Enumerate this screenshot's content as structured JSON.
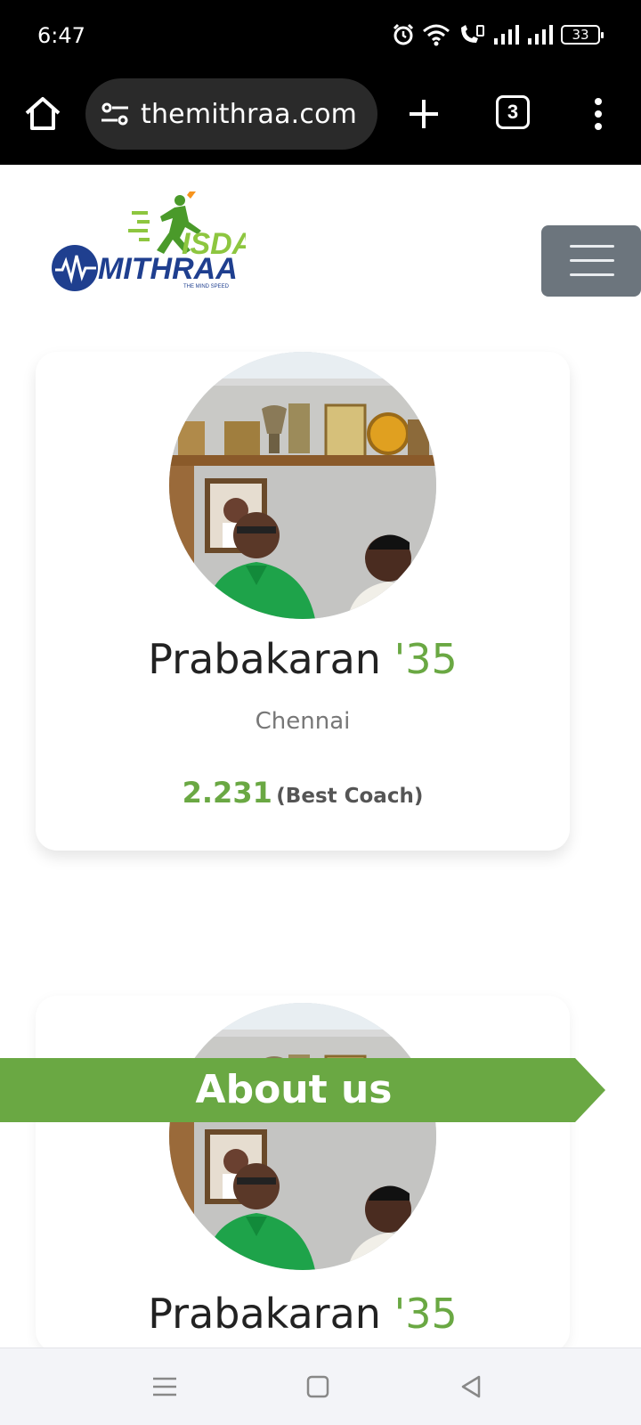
{
  "status_bar": {
    "time": "6:47",
    "battery": "33"
  },
  "browser": {
    "url": "themithraa.com",
    "tab_count": "3"
  },
  "site": {
    "logo": {
      "top_text": "ISDA",
      "main_text": "MITHRAA",
      "tagline": "THE MIND SPEED"
    }
  },
  "cards": [
    {
      "name": "Prabakaran ",
      "year": "'35",
      "city": "Chennai",
      "score": "2.231",
      "score_label": "(Best Coach)"
    },
    {
      "name": "Prabakaran ",
      "year": "'35"
    }
  ],
  "about_banner": {
    "label": "About us"
  },
  "colors": {
    "accent": "#6aa843",
    "banner": "#6aa843",
    "menu_button": "#6c757d",
    "logo_blue": "#1f3f8f"
  }
}
